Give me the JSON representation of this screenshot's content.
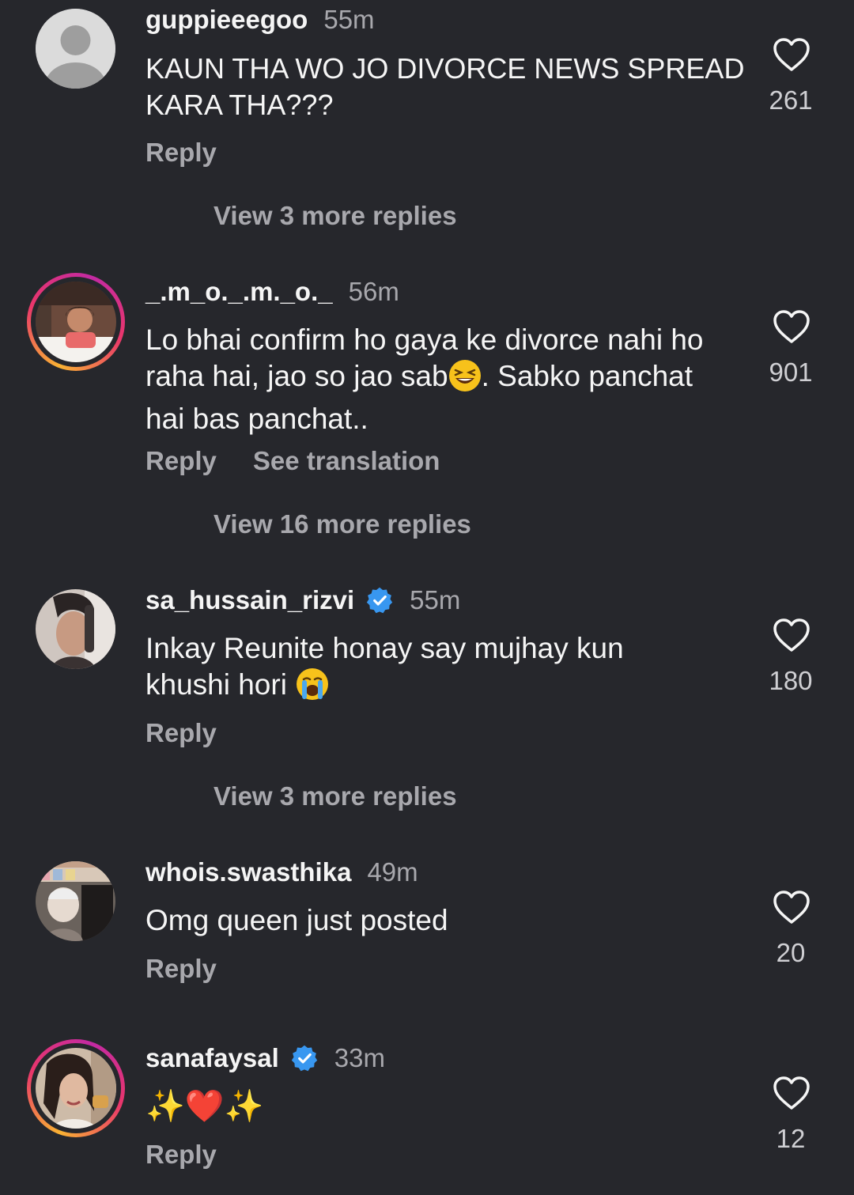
{
  "comments": [
    {
      "username": "guppieeegoo",
      "time": "55m",
      "text": "KAUN THA WO JO DIVORCE NEWS SPREAD KARA THA???",
      "reply_label": "Reply",
      "view_replies": "View 3 more replies",
      "likes": "261"
    },
    {
      "username": "_.m_o._.m._o._",
      "time": "56m",
      "text_line1": "Lo bhai confirm ho gaya ke divorce nahi ho",
      "text_line2a": "raha hai, jao so jao sab",
      "text_line2b": ". Sabko panchat",
      "text_line3": "hai bas panchat..",
      "reply_label": "Reply",
      "translate_label": "See translation",
      "view_replies": "View 16 more replies",
      "likes": "901"
    },
    {
      "username": "sa_hussain_rizvi",
      "time": "55m",
      "text_line1": "Inkay Reunite honay say mujhay kun",
      "text_line2": "khushi hori ",
      "reply_label": "Reply",
      "view_replies": "View 3 more replies",
      "likes": "180"
    },
    {
      "username": "whois.swasthika",
      "time": "49m",
      "text": "Omg queen just posted",
      "reply_label": "Reply",
      "likes": "20"
    },
    {
      "username": "sanafaysal",
      "time": "33m",
      "text": "✨❤️✨",
      "reply_label": "Reply",
      "likes": "12"
    }
  ],
  "icons": {
    "like": "heart-outline-icon",
    "verified": "verified-badge-icon"
  },
  "colors": {
    "background": "#26272c",
    "verified": "#3897f0",
    "secondary_text": "#a8a8ad"
  }
}
